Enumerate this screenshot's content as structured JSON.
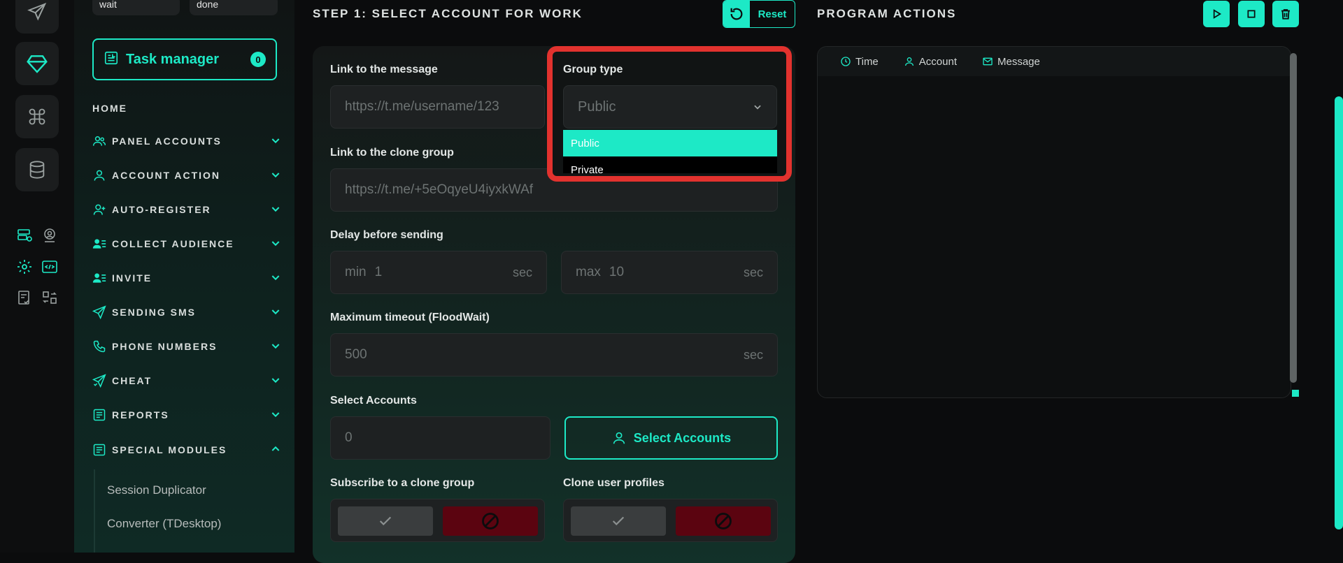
{
  "rail": {
    "icons": [
      "send-icon",
      "diamond-icon",
      "command-icon",
      "database-icon"
    ],
    "small_icons": [
      "server-check-icon",
      "user-pin-icon",
      "gear-icon",
      "code-window-icon",
      "checklist-icon",
      "swap-icon"
    ]
  },
  "sidebar": {
    "status_wait": "wait",
    "status_done": "done",
    "task_manager": {
      "label": "Task manager",
      "count": "0"
    },
    "home": "HOME",
    "items": [
      {
        "label": "PANEL ACCOUNTS",
        "icon": "users-icon"
      },
      {
        "label": "ACCOUNT ACTION",
        "icon": "user-icon"
      },
      {
        "label": "AUTO-REGISTER",
        "icon": "user-plus-icon"
      },
      {
        "label": "COLLECT AUDIENCE",
        "icon": "user-list-icon"
      },
      {
        "label": "INVITE",
        "icon": "user-list-icon"
      },
      {
        "label": "SENDING SMS",
        "icon": "send-icon"
      },
      {
        "label": "PHONE NUMBERS",
        "icon": "phone-icon"
      },
      {
        "label": "CHEAT",
        "icon": "send-check-icon"
      },
      {
        "label": "REPORTS",
        "icon": "report-icon"
      },
      {
        "label": "SPECIAL MODULES",
        "icon": "report-icon"
      }
    ],
    "sub_items": [
      "Session Duplicator",
      "Converter (TDesktop)"
    ]
  },
  "step": {
    "title": "STEP 1: SELECT ACCOUNT FOR WORK",
    "reset": "Reset",
    "link_message_label": "Link to the message",
    "link_message_placeholder": "https://t.me/username/123",
    "group_type_label": "Group type",
    "group_type_value": "Public",
    "group_type_options": [
      "Public",
      "Private"
    ],
    "clone_group_label": "Link to the clone group",
    "clone_group_placeholder": "https://t.me/+5eOqyeU4iyxkWAf",
    "delay_label": "Delay before sending",
    "delay_min_prefix": "min",
    "delay_min": "1",
    "delay_max_prefix": "max",
    "delay_max": "10",
    "unit": "sec",
    "timeout_label": "Maximum timeout (FloodWait)",
    "timeout_value": "500",
    "select_accounts_label": "Select Accounts",
    "select_accounts_count": "0",
    "select_accounts_button": "Select Accounts",
    "subscribe_label": "Subscribe to a clone group",
    "clone_profiles_label": "Clone user profiles"
  },
  "program": {
    "title": "PROGRAM ACTIONS",
    "columns": [
      "Time",
      "Account",
      "Message"
    ]
  },
  "colors": {
    "accent": "#1de9c6",
    "danger": "#e2322e",
    "off": "#5b0410"
  }
}
